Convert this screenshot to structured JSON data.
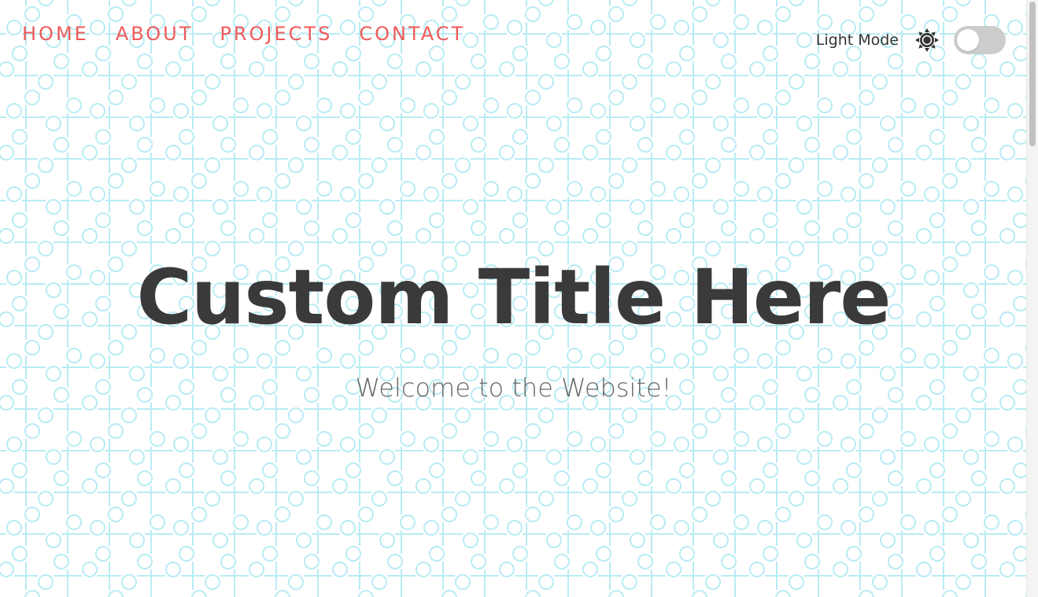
{
  "nav": {
    "items": [
      {
        "label": "HOME"
      },
      {
        "label": "ABOUT"
      },
      {
        "label": "PROJECTS"
      },
      {
        "label": "CONTACT"
      }
    ]
  },
  "mode": {
    "label": "Light Mode",
    "icon": "sun-icon",
    "toggle_on": false
  },
  "hero": {
    "title": "Custom Title Here",
    "subtitle": "Welcome to the Website!"
  },
  "colors": {
    "nav_link": "#ef5a5a",
    "pattern_stroke": "#b8ecf4",
    "title": "#3a3a3a",
    "subtitle": "#666666",
    "toggle_track": "#cccccc"
  }
}
